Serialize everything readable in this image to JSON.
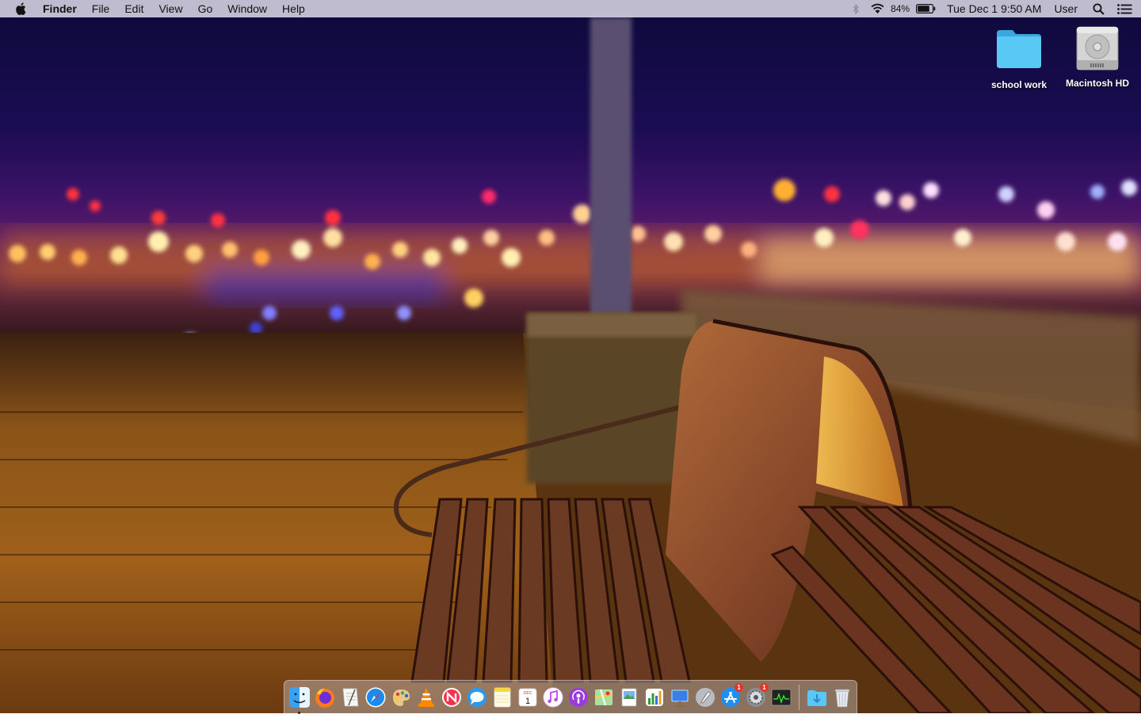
{
  "menubar": {
    "apple_icon": "apple-logo-icon",
    "app_name": "Finder",
    "menus": [
      "File",
      "Edit",
      "View",
      "Go",
      "Window",
      "Help"
    ],
    "status": {
      "bluetooth_icon": "bluetooth-icon",
      "wifi_icon": "wifi-icon",
      "battery_percent": "84%",
      "battery_level": 0.84,
      "battery_icon": "battery-icon",
      "datetime": "Tue Dec 1  9:50 AM",
      "user": "User",
      "spotlight_icon": "search-icon",
      "notification_icon": "notification-center-icon"
    },
    "background": "#e8e4f0"
  },
  "desktop": {
    "icons": [
      {
        "label": "school work",
        "icon": "folder-icon",
        "color": "#5ac8f5"
      },
      {
        "label": "Macintosh HD",
        "icon": "hard-drive-icon",
        "color": "#c8c8c8"
      }
    ]
  },
  "dock": {
    "apps": [
      {
        "name": "Finder",
        "icon": "finder-icon",
        "running": true
      },
      {
        "name": "Firefox",
        "icon": "firefox-icon"
      },
      {
        "name": "TextEdit",
        "icon": "textedit-icon"
      },
      {
        "name": "Safari",
        "icon": "safari-icon"
      },
      {
        "name": "Pixelmator",
        "icon": "pixelmator-icon"
      },
      {
        "name": "VLC",
        "icon": "vlc-icon"
      },
      {
        "name": "News",
        "icon": "news-icon"
      },
      {
        "name": "Messages",
        "icon": "messages-icon"
      },
      {
        "name": "Notes",
        "icon": "notes-icon"
      },
      {
        "name": "Calendar",
        "icon": "calendar-icon",
        "month": "DEC",
        "day": "1"
      },
      {
        "name": "iTunes",
        "icon": "itunes-icon"
      },
      {
        "name": "Podcasts",
        "icon": "podcasts-icon"
      },
      {
        "name": "Maps",
        "icon": "maps-icon"
      },
      {
        "name": "Preview",
        "icon": "preview-icon"
      },
      {
        "name": "Numbers",
        "icon": "numbers-icon"
      },
      {
        "name": "Keynote",
        "icon": "keynote-icon"
      },
      {
        "name": "Launchpad",
        "icon": "launchpad-icon"
      },
      {
        "name": "App Store",
        "icon": "app-store-icon",
        "badge": "1"
      },
      {
        "name": "System Preferences",
        "icon": "system-preferences-icon",
        "badge": "1"
      },
      {
        "name": "Activity Monitor",
        "icon": "activity-monitor-icon"
      }
    ],
    "stacks": [
      {
        "name": "Downloads",
        "icon": "downloads-folder-icon"
      },
      {
        "name": "Trash",
        "icon": "trash-icon"
      }
    ]
  }
}
